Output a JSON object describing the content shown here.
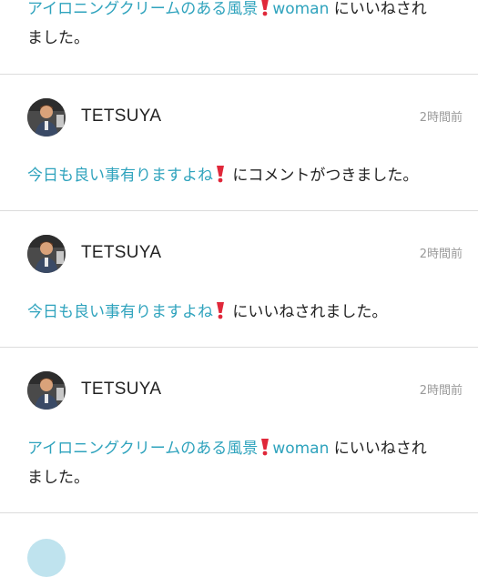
{
  "notifications": [
    {
      "post_title": "アイロニングクリームのある風景",
      "post_title_suffix": "woman",
      "action_text_line1": "にいいねされ",
      "action_text_line2": "ました。"
    },
    {
      "user": "TETSUYA",
      "time": "2時間前",
      "post_title": "今日も良い事有りますよね",
      "action_text": "にコメントがつきました。"
    },
    {
      "user": "TETSUYA",
      "time": "2時間前",
      "post_title": "今日も良い事有りますよね",
      "action_text": "にいいねされました。"
    },
    {
      "user": "TETSUYA",
      "time": "2時間前",
      "post_title": "アイロニングクリームのある風景",
      "post_title_suffix": "woman",
      "action_text_line1": "にいいねされ",
      "action_text_line2": "ました。"
    }
  ],
  "colors": {
    "link": "#2fa3bd",
    "divider": "#dcdcdc",
    "time": "#9a9a9a",
    "emoji": "#e0283a"
  },
  "icons": {
    "exclamation": "heavy-exclamation-mark-icon",
    "avatar": "user-avatar"
  }
}
